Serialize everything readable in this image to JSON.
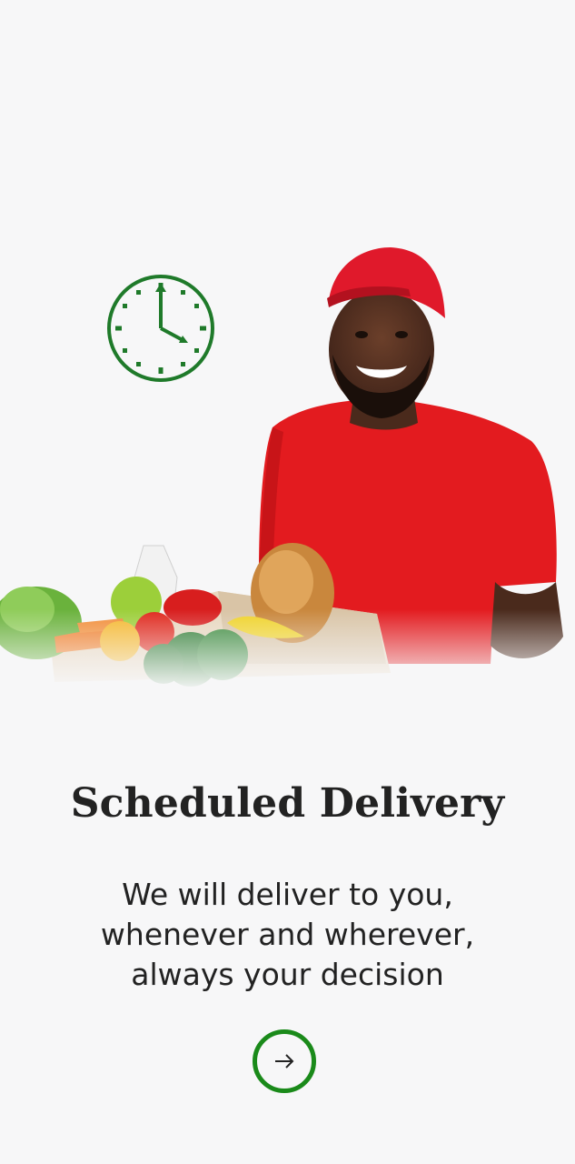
{
  "onboarding": {
    "title": "Scheduled Delivery",
    "description_lines": [
      "We will deliver to you,",
      "whenever and wherever,",
      "always your decision"
    ],
    "next_button_icon": "arrow-right-icon"
  },
  "hero": {
    "clock_icon": "clock-icon",
    "image_subject": "delivery-person-with-groceries"
  },
  "colors": {
    "accent": "#1a8a1a",
    "background": "#f7f7f8",
    "text": "#222222"
  }
}
